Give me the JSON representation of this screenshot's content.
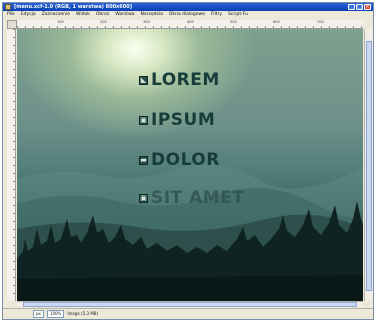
{
  "window": {
    "title": "[menu.xcf-1.0 (RGB, 1 warstwa) 800x600]",
    "controls": {
      "minimize": "_",
      "maximize": "□",
      "close": "×"
    }
  },
  "menubar": {
    "items": [
      "Plik",
      "Edycja",
      "Zaznaczenie",
      "Widok",
      "Obraz",
      "Warstwa",
      "Narzędzia",
      "Okna dialogowe",
      "Filtry",
      "Script-Fu"
    ]
  },
  "rulers": {
    "top_ticks": [
      "100",
      "200",
      "300",
      "400",
      "500",
      "600",
      "700"
    ]
  },
  "canvas": {
    "menu_entries": [
      {
        "icon": "◣",
        "label": "LOREM"
      },
      {
        "icon": "▣",
        "label": "IPSUM"
      },
      {
        "icon": "▬",
        "label": "DOLOR"
      },
      {
        "icon": "▣",
        "label": "SIT AMET"
      }
    ]
  },
  "statusbar": {
    "unit": "px",
    "zoom": "100%",
    "info": "Image (5,3 MB)"
  },
  "colors": {
    "titlebar": "#0a3fb2",
    "menu_text": "#163d3a",
    "sky_light": "#fbfff0",
    "forest": "#0f2322"
  }
}
